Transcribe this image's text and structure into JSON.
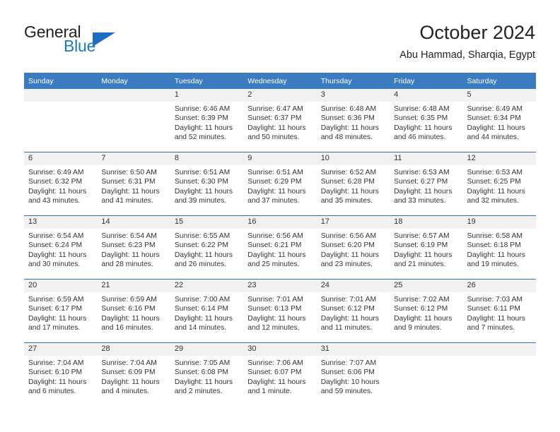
{
  "brand": {
    "name_top": "General",
    "name_bottom": "Blue",
    "triangle_color": "#1b6ec2",
    "blue_text_color": "#1b7ac4"
  },
  "header": {
    "title": "October 2024",
    "subtitle": "Abu Hammad, Sharqia, Egypt"
  },
  "theme": {
    "header_blue": "#3b7cc0",
    "row_rule_blue": "#2f6fb2",
    "daynum_band": "#f1f1f1"
  },
  "weekday_headers": [
    "Sunday",
    "Monday",
    "Tuesday",
    "Wednesday",
    "Thursday",
    "Friday",
    "Saturday"
  ],
  "weeks": [
    [
      {
        "day": "",
        "sunrise": "",
        "sunset": "",
        "daylight": "",
        "empty": true
      },
      {
        "day": "",
        "sunrise": "",
        "sunset": "",
        "daylight": "",
        "empty": true
      },
      {
        "day": "1",
        "sunrise": "Sunrise: 6:46 AM",
        "sunset": "Sunset: 6:39 PM",
        "daylight": "Daylight: 11 hours and 52 minutes."
      },
      {
        "day": "2",
        "sunrise": "Sunrise: 6:47 AM",
        "sunset": "Sunset: 6:37 PM",
        "daylight": "Daylight: 11 hours and 50 minutes."
      },
      {
        "day": "3",
        "sunrise": "Sunrise: 6:48 AM",
        "sunset": "Sunset: 6:36 PM",
        "daylight": "Daylight: 11 hours and 48 minutes."
      },
      {
        "day": "4",
        "sunrise": "Sunrise: 6:48 AM",
        "sunset": "Sunset: 6:35 PM",
        "daylight": "Daylight: 11 hours and 46 minutes."
      },
      {
        "day": "5",
        "sunrise": "Sunrise: 6:49 AM",
        "sunset": "Sunset: 6:34 PM",
        "daylight": "Daylight: 11 hours and 44 minutes."
      }
    ],
    [
      {
        "day": "6",
        "sunrise": "Sunrise: 6:49 AM",
        "sunset": "Sunset: 6:32 PM",
        "daylight": "Daylight: 11 hours and 43 minutes."
      },
      {
        "day": "7",
        "sunrise": "Sunrise: 6:50 AM",
        "sunset": "Sunset: 6:31 PM",
        "daylight": "Daylight: 11 hours and 41 minutes."
      },
      {
        "day": "8",
        "sunrise": "Sunrise: 6:51 AM",
        "sunset": "Sunset: 6:30 PM",
        "daylight": "Daylight: 11 hours and 39 minutes."
      },
      {
        "day": "9",
        "sunrise": "Sunrise: 6:51 AM",
        "sunset": "Sunset: 6:29 PM",
        "daylight": "Daylight: 11 hours and 37 minutes."
      },
      {
        "day": "10",
        "sunrise": "Sunrise: 6:52 AM",
        "sunset": "Sunset: 6:28 PM",
        "daylight": "Daylight: 11 hours and 35 minutes."
      },
      {
        "day": "11",
        "sunrise": "Sunrise: 6:53 AM",
        "sunset": "Sunset: 6:27 PM",
        "daylight": "Daylight: 11 hours and 33 minutes."
      },
      {
        "day": "12",
        "sunrise": "Sunrise: 6:53 AM",
        "sunset": "Sunset: 6:25 PM",
        "daylight": "Daylight: 11 hours and 32 minutes."
      }
    ],
    [
      {
        "day": "13",
        "sunrise": "Sunrise: 6:54 AM",
        "sunset": "Sunset: 6:24 PM",
        "daylight": "Daylight: 11 hours and 30 minutes."
      },
      {
        "day": "14",
        "sunrise": "Sunrise: 6:54 AM",
        "sunset": "Sunset: 6:23 PM",
        "daylight": "Daylight: 11 hours and 28 minutes."
      },
      {
        "day": "15",
        "sunrise": "Sunrise: 6:55 AM",
        "sunset": "Sunset: 6:22 PM",
        "daylight": "Daylight: 11 hours and 26 minutes."
      },
      {
        "day": "16",
        "sunrise": "Sunrise: 6:56 AM",
        "sunset": "Sunset: 6:21 PM",
        "daylight": "Daylight: 11 hours and 25 minutes."
      },
      {
        "day": "17",
        "sunrise": "Sunrise: 6:56 AM",
        "sunset": "Sunset: 6:20 PM",
        "daylight": "Daylight: 11 hours and 23 minutes."
      },
      {
        "day": "18",
        "sunrise": "Sunrise: 6:57 AM",
        "sunset": "Sunset: 6:19 PM",
        "daylight": "Daylight: 11 hours and 21 minutes."
      },
      {
        "day": "19",
        "sunrise": "Sunrise: 6:58 AM",
        "sunset": "Sunset: 6:18 PM",
        "daylight": "Daylight: 11 hours and 19 minutes."
      }
    ],
    [
      {
        "day": "20",
        "sunrise": "Sunrise: 6:59 AM",
        "sunset": "Sunset: 6:17 PM",
        "daylight": "Daylight: 11 hours and 17 minutes."
      },
      {
        "day": "21",
        "sunrise": "Sunrise: 6:59 AM",
        "sunset": "Sunset: 6:16 PM",
        "daylight": "Daylight: 11 hours and 16 minutes."
      },
      {
        "day": "22",
        "sunrise": "Sunrise: 7:00 AM",
        "sunset": "Sunset: 6:14 PM",
        "daylight": "Daylight: 11 hours and 14 minutes."
      },
      {
        "day": "23",
        "sunrise": "Sunrise: 7:01 AM",
        "sunset": "Sunset: 6:13 PM",
        "daylight": "Daylight: 11 hours and 12 minutes."
      },
      {
        "day": "24",
        "sunrise": "Sunrise: 7:01 AM",
        "sunset": "Sunset: 6:12 PM",
        "daylight": "Daylight: 11 hours and 11 minutes."
      },
      {
        "day": "25",
        "sunrise": "Sunrise: 7:02 AM",
        "sunset": "Sunset: 6:12 PM",
        "daylight": "Daylight: 11 hours and 9 minutes."
      },
      {
        "day": "26",
        "sunrise": "Sunrise: 7:03 AM",
        "sunset": "Sunset: 6:11 PM",
        "daylight": "Daylight: 11 hours and 7 minutes."
      }
    ],
    [
      {
        "day": "27",
        "sunrise": "Sunrise: 7:04 AM",
        "sunset": "Sunset: 6:10 PM",
        "daylight": "Daylight: 11 hours and 6 minutes."
      },
      {
        "day": "28",
        "sunrise": "Sunrise: 7:04 AM",
        "sunset": "Sunset: 6:09 PM",
        "daylight": "Daylight: 11 hours and 4 minutes."
      },
      {
        "day": "29",
        "sunrise": "Sunrise: 7:05 AM",
        "sunset": "Sunset: 6:08 PM",
        "daylight": "Daylight: 11 hours and 2 minutes."
      },
      {
        "day": "30",
        "sunrise": "Sunrise: 7:06 AM",
        "sunset": "Sunset: 6:07 PM",
        "daylight": "Daylight: 11 hours and 1 minute."
      },
      {
        "day": "31",
        "sunrise": "Sunrise: 7:07 AM",
        "sunset": "Sunset: 6:06 PM",
        "daylight": "Daylight: 10 hours and 59 minutes."
      },
      {
        "day": "",
        "sunrise": "",
        "sunset": "",
        "daylight": "",
        "empty": true
      },
      {
        "day": "",
        "sunrise": "",
        "sunset": "",
        "daylight": "",
        "empty": true
      }
    ]
  ]
}
